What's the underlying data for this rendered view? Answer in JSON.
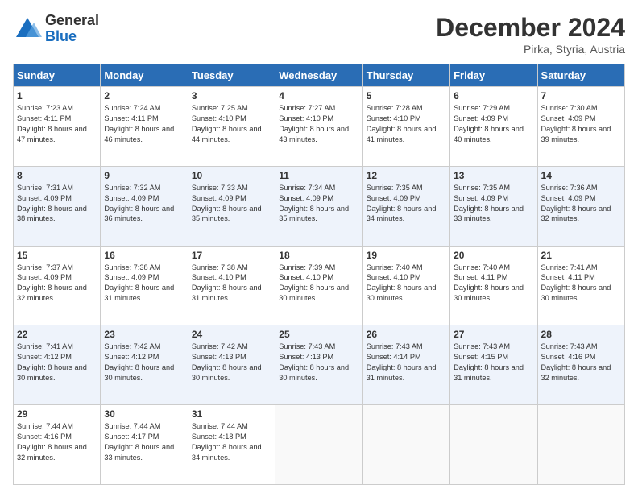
{
  "header": {
    "logo_general": "General",
    "logo_blue": "Blue",
    "month_title": "December 2024",
    "location": "Pirka, Styria, Austria"
  },
  "weekdays": [
    "Sunday",
    "Monday",
    "Tuesday",
    "Wednesday",
    "Thursday",
    "Friday",
    "Saturday"
  ],
  "weeks": [
    [
      {
        "day": "1",
        "sunrise": "Sunrise: 7:23 AM",
        "sunset": "Sunset: 4:11 PM",
        "daylight": "Daylight: 8 hours and 47 minutes."
      },
      {
        "day": "2",
        "sunrise": "Sunrise: 7:24 AM",
        "sunset": "Sunset: 4:11 PM",
        "daylight": "Daylight: 8 hours and 46 minutes."
      },
      {
        "day": "3",
        "sunrise": "Sunrise: 7:25 AM",
        "sunset": "Sunset: 4:10 PM",
        "daylight": "Daylight: 8 hours and 44 minutes."
      },
      {
        "day": "4",
        "sunrise": "Sunrise: 7:27 AM",
        "sunset": "Sunset: 4:10 PM",
        "daylight": "Daylight: 8 hours and 43 minutes."
      },
      {
        "day": "5",
        "sunrise": "Sunrise: 7:28 AM",
        "sunset": "Sunset: 4:10 PM",
        "daylight": "Daylight: 8 hours and 41 minutes."
      },
      {
        "day": "6",
        "sunrise": "Sunrise: 7:29 AM",
        "sunset": "Sunset: 4:09 PM",
        "daylight": "Daylight: 8 hours and 40 minutes."
      },
      {
        "day": "7",
        "sunrise": "Sunrise: 7:30 AM",
        "sunset": "Sunset: 4:09 PM",
        "daylight": "Daylight: 8 hours and 39 minutes."
      }
    ],
    [
      {
        "day": "8",
        "sunrise": "Sunrise: 7:31 AM",
        "sunset": "Sunset: 4:09 PM",
        "daylight": "Daylight: 8 hours and 38 minutes."
      },
      {
        "day": "9",
        "sunrise": "Sunrise: 7:32 AM",
        "sunset": "Sunset: 4:09 PM",
        "daylight": "Daylight: 8 hours and 36 minutes."
      },
      {
        "day": "10",
        "sunrise": "Sunrise: 7:33 AM",
        "sunset": "Sunset: 4:09 PM",
        "daylight": "Daylight: 8 hours and 35 minutes."
      },
      {
        "day": "11",
        "sunrise": "Sunrise: 7:34 AM",
        "sunset": "Sunset: 4:09 PM",
        "daylight": "Daylight: 8 hours and 35 minutes."
      },
      {
        "day": "12",
        "sunrise": "Sunrise: 7:35 AM",
        "sunset": "Sunset: 4:09 PM",
        "daylight": "Daylight: 8 hours and 34 minutes."
      },
      {
        "day": "13",
        "sunrise": "Sunrise: 7:35 AM",
        "sunset": "Sunset: 4:09 PM",
        "daylight": "Daylight: 8 hours and 33 minutes."
      },
      {
        "day": "14",
        "sunrise": "Sunrise: 7:36 AM",
        "sunset": "Sunset: 4:09 PM",
        "daylight": "Daylight: 8 hours and 32 minutes."
      }
    ],
    [
      {
        "day": "15",
        "sunrise": "Sunrise: 7:37 AM",
        "sunset": "Sunset: 4:09 PM",
        "daylight": "Daylight: 8 hours and 32 minutes."
      },
      {
        "day": "16",
        "sunrise": "Sunrise: 7:38 AM",
        "sunset": "Sunset: 4:09 PM",
        "daylight": "Daylight: 8 hours and 31 minutes."
      },
      {
        "day": "17",
        "sunrise": "Sunrise: 7:38 AM",
        "sunset": "Sunset: 4:10 PM",
        "daylight": "Daylight: 8 hours and 31 minutes."
      },
      {
        "day": "18",
        "sunrise": "Sunrise: 7:39 AM",
        "sunset": "Sunset: 4:10 PM",
        "daylight": "Daylight: 8 hours and 30 minutes."
      },
      {
        "day": "19",
        "sunrise": "Sunrise: 7:40 AM",
        "sunset": "Sunset: 4:10 PM",
        "daylight": "Daylight: 8 hours and 30 minutes."
      },
      {
        "day": "20",
        "sunrise": "Sunrise: 7:40 AM",
        "sunset": "Sunset: 4:11 PM",
        "daylight": "Daylight: 8 hours and 30 minutes."
      },
      {
        "day": "21",
        "sunrise": "Sunrise: 7:41 AM",
        "sunset": "Sunset: 4:11 PM",
        "daylight": "Daylight: 8 hours and 30 minutes."
      }
    ],
    [
      {
        "day": "22",
        "sunrise": "Sunrise: 7:41 AM",
        "sunset": "Sunset: 4:12 PM",
        "daylight": "Daylight: 8 hours and 30 minutes."
      },
      {
        "day": "23",
        "sunrise": "Sunrise: 7:42 AM",
        "sunset": "Sunset: 4:12 PM",
        "daylight": "Daylight: 8 hours and 30 minutes."
      },
      {
        "day": "24",
        "sunrise": "Sunrise: 7:42 AM",
        "sunset": "Sunset: 4:13 PM",
        "daylight": "Daylight: 8 hours and 30 minutes."
      },
      {
        "day": "25",
        "sunrise": "Sunrise: 7:43 AM",
        "sunset": "Sunset: 4:13 PM",
        "daylight": "Daylight: 8 hours and 30 minutes."
      },
      {
        "day": "26",
        "sunrise": "Sunrise: 7:43 AM",
        "sunset": "Sunset: 4:14 PM",
        "daylight": "Daylight: 8 hours and 31 minutes."
      },
      {
        "day": "27",
        "sunrise": "Sunrise: 7:43 AM",
        "sunset": "Sunset: 4:15 PM",
        "daylight": "Daylight: 8 hours and 31 minutes."
      },
      {
        "day": "28",
        "sunrise": "Sunrise: 7:43 AM",
        "sunset": "Sunset: 4:16 PM",
        "daylight": "Daylight: 8 hours and 32 minutes."
      }
    ],
    [
      {
        "day": "29",
        "sunrise": "Sunrise: 7:44 AM",
        "sunset": "Sunset: 4:16 PM",
        "daylight": "Daylight: 8 hours and 32 minutes."
      },
      {
        "day": "30",
        "sunrise": "Sunrise: 7:44 AM",
        "sunset": "Sunset: 4:17 PM",
        "daylight": "Daylight: 8 hours and 33 minutes."
      },
      {
        "day": "31",
        "sunrise": "Sunrise: 7:44 AM",
        "sunset": "Sunset: 4:18 PM",
        "daylight": "Daylight: 8 hours and 34 minutes."
      },
      null,
      null,
      null,
      null
    ]
  ]
}
